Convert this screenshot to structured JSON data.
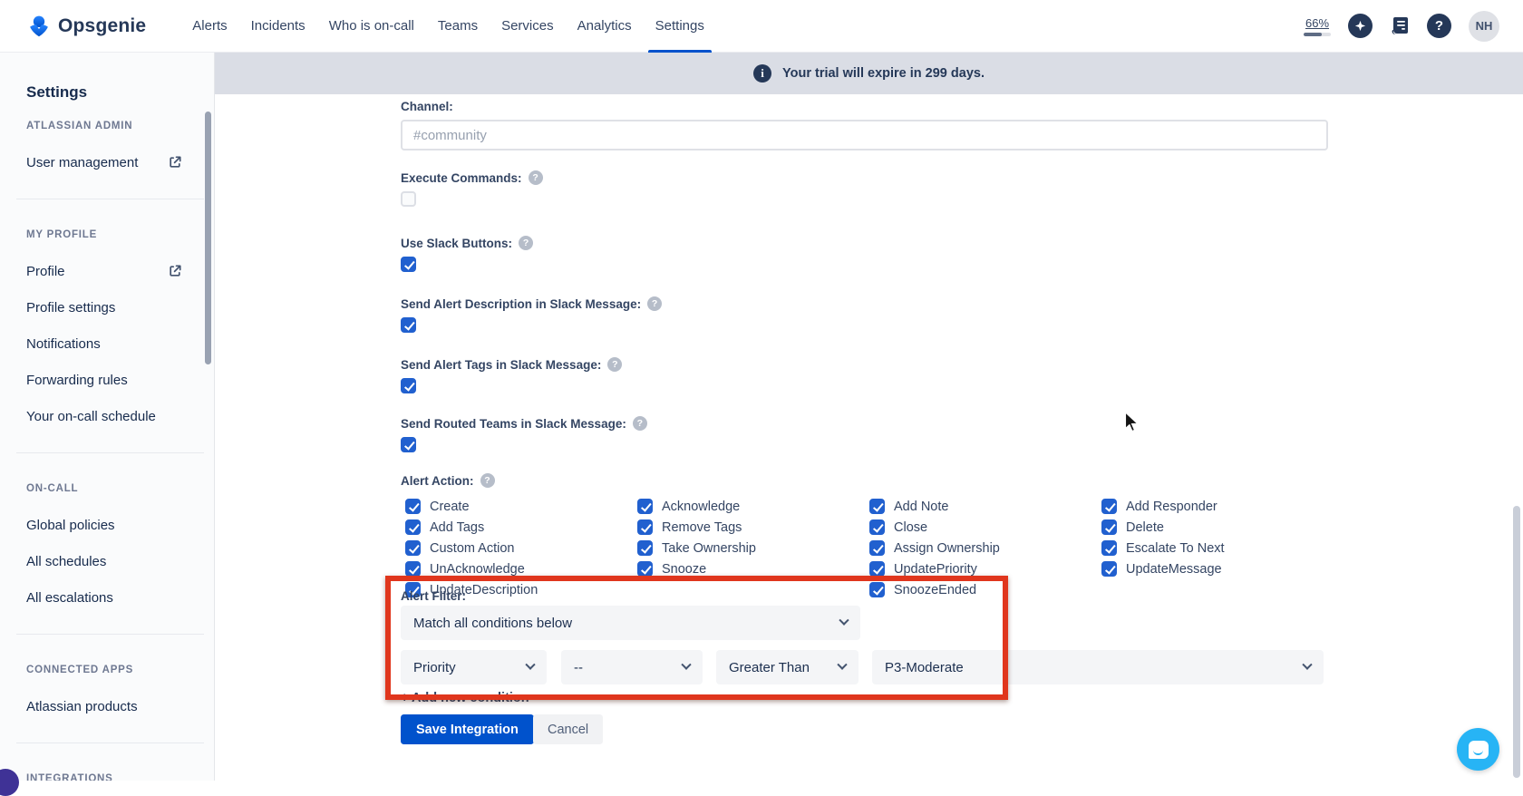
{
  "navbar": {
    "brand": "Opsgenie",
    "items": [
      "Alerts",
      "Incidents",
      "Who is on-call",
      "Teams",
      "Services",
      "Analytics",
      "Settings"
    ],
    "active_item": "Settings",
    "trial_percent": "66%",
    "avatar_initials": "NH",
    "icons": [
      "opsgenie-logo-icon",
      "compass-icon",
      "release-notes-icon",
      "help-icon"
    ]
  },
  "banner": {
    "icon": "info-icon",
    "text": "Your trial will expire in 299 days."
  },
  "sidebar": {
    "title": "Settings",
    "sections": [
      {
        "header": "ATLASSIAN ADMIN",
        "items": [
          "User management"
        ]
      },
      {
        "header": "MY PROFILE",
        "items": [
          "Profile",
          "Profile settings",
          "Notifications",
          "Forwarding rules",
          "Your on-call schedule"
        ]
      },
      {
        "header": "ON-CALL",
        "items": [
          "Global policies",
          "All schedules",
          "All escalations"
        ]
      },
      {
        "header": "CONNECTED APPS",
        "items": [
          "Atlassian products"
        ]
      },
      {
        "header": "INTEGRATIONS",
        "items": []
      }
    ]
  },
  "form": {
    "channel": {
      "label": "Channel:",
      "value": "",
      "placeholder": "#community"
    },
    "toggles": [
      {
        "label": "Execute Commands:",
        "checked": false
      },
      {
        "label": "Use Slack Buttons:",
        "checked": true
      },
      {
        "label": "Send Alert Description in Slack Message:",
        "checked": true
      },
      {
        "label": "Send Alert Tags in Slack Message:",
        "checked": true
      },
      {
        "label": "Send Routed Teams in Slack Message:",
        "checked": true
      }
    ],
    "alert_action": {
      "label": "Alert Action:",
      "cells": [
        {
          "label": "Create",
          "checked": true
        },
        {
          "label": "Acknowledge",
          "checked": true
        },
        {
          "label": "Add Note",
          "checked": true
        },
        {
          "label": "Add Responder",
          "checked": true
        },
        {
          "label": "Add Tags",
          "checked": true
        },
        {
          "label": "Remove Tags",
          "checked": true
        },
        {
          "label": "Close",
          "checked": true
        },
        {
          "label": "Delete",
          "checked": true
        },
        {
          "label": "Custom Action",
          "checked": true
        },
        {
          "label": "Take Ownership",
          "checked": true
        },
        {
          "label": "Assign Ownership",
          "checked": true
        },
        {
          "label": "Escalate To Next",
          "checked": true
        },
        {
          "label": "UnAcknowledge",
          "checked": true
        },
        {
          "label": "Snooze",
          "checked": true
        },
        {
          "label": "UpdatePriority",
          "checked": true
        },
        {
          "label": "UpdateMessage",
          "checked": true
        },
        {
          "label": "UpdateDescription",
          "checked": true
        },
        {
          "label": "SnoozeEnded",
          "checked": true
        }
      ]
    },
    "alert_filter": {
      "label": "Alert Filter:",
      "match_select": "Match all conditions below",
      "condition": {
        "field": "Priority",
        "key": "--",
        "operator": "Greater Than",
        "value": "P3-Moderate"
      },
      "add_link": "+ Add new condition"
    },
    "buttons": {
      "save": "Save Integration",
      "cancel": "Cancel"
    }
  },
  "colors": {
    "primary_blue": "#0052cc",
    "checkbox_blue": "#2160cf",
    "annotation_red": "#e0361d",
    "chat_blue": "#27b4f5",
    "banner_bg": "#dadde5"
  }
}
